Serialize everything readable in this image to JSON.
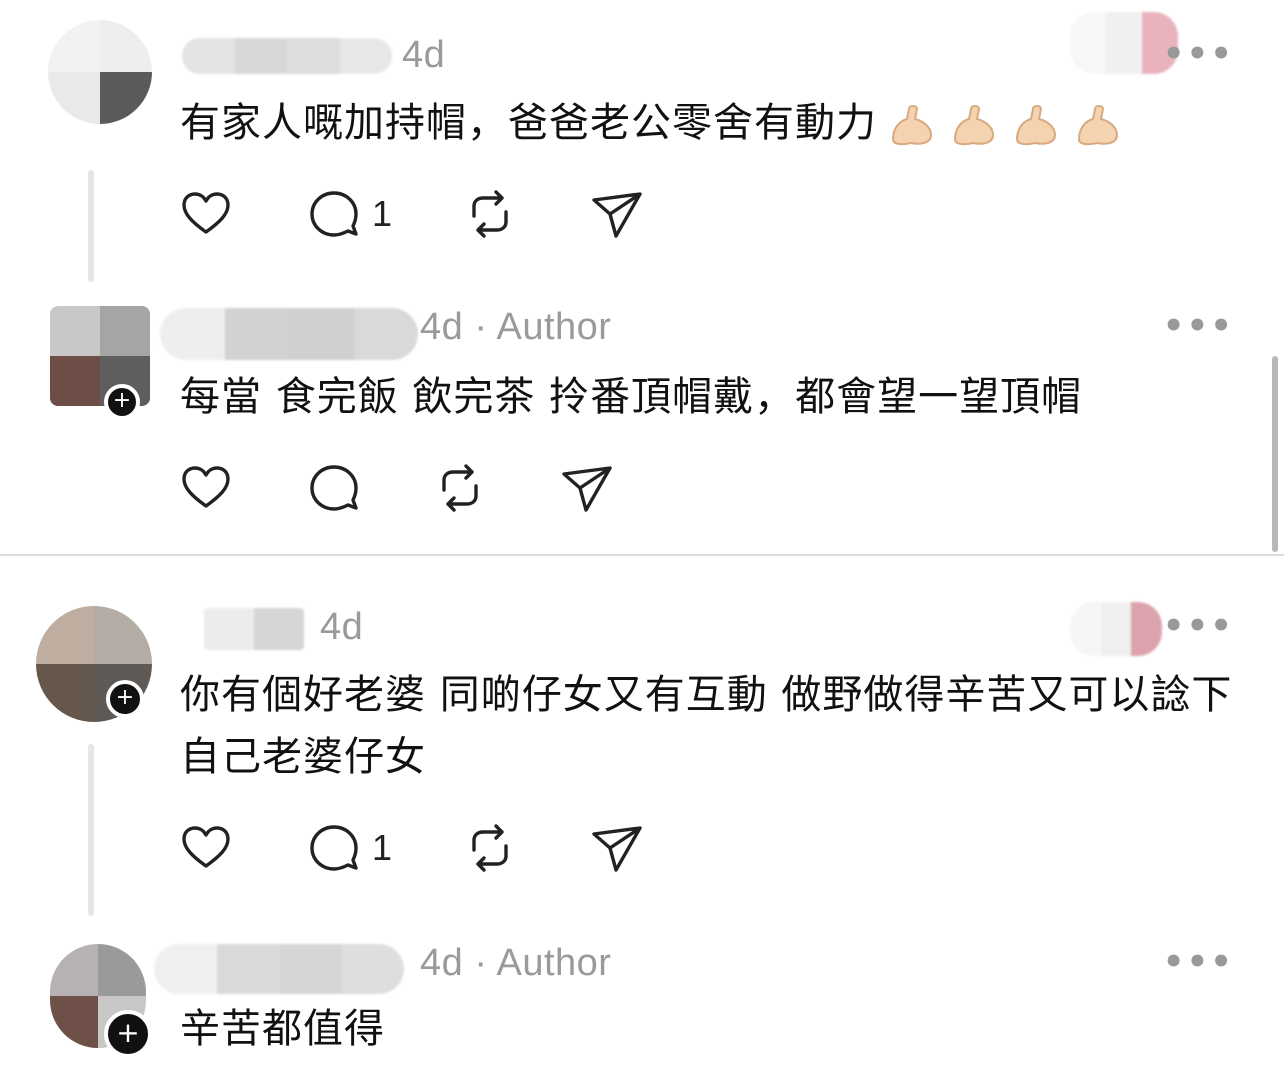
{
  "comments": [
    {
      "time": "4d",
      "author_badge": "",
      "text": "有家人嘅加持帽，爸爸老公零舍有動力",
      "emoji": [
        "flexed-biceps",
        "flexed-biceps",
        "flexed-biceps",
        "flexed-biceps"
      ],
      "reply_count": "1"
    },
    {
      "time": "4d",
      "author_badge": "Author",
      "text": "每當 食完飯 飲完茶 拎番頂帽戴，都會望一望頂帽",
      "reply_count": ""
    },
    {
      "time": "4d",
      "author_badge": "",
      "text": "你有個好老婆 同啲仔女又有互動 做野做得辛苦又可以諗下自己老婆仔女",
      "reply_count": "1"
    },
    {
      "time": "4d",
      "author_badge": "Author",
      "text": "辛苦都值得",
      "reply_count": ""
    }
  ],
  "meta_separator": "·",
  "more_label": "•••",
  "follow_label": "+",
  "icons": {
    "like": "heart-icon",
    "reply": "comment-icon",
    "repost": "repost-icon",
    "share": "send-icon"
  },
  "colors": {
    "meta_text": "#9a9a9a",
    "divider": "#dcdcdc",
    "thread_line": "#e6e6e6"
  }
}
